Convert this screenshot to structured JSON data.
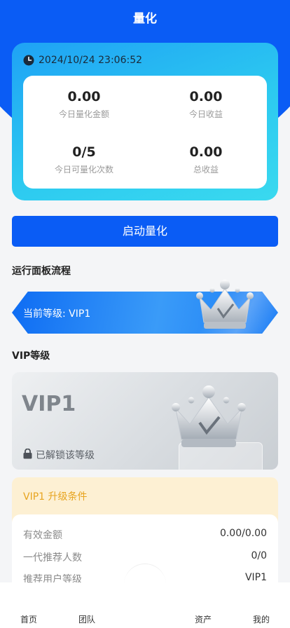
{
  "header": {
    "title": "量化"
  },
  "stats": {
    "datetime": "2024/10/24 23:06:52",
    "items": [
      {
        "value": "0.00",
        "label": "今日量化金额"
      },
      {
        "value": "0.00",
        "label": "今日收益"
      },
      {
        "value": "0/5",
        "label": "今日可量化次数"
      },
      {
        "value": "0.00",
        "label": "总收益"
      }
    ]
  },
  "start_button": {
    "label": "启动量化"
  },
  "process": {
    "title": "运行面板流程",
    "current_level": "当前等级: VIP1"
  },
  "vip": {
    "title": "VIP等级",
    "name": "VIP1",
    "status": "已解锁该等级"
  },
  "upgrade": {
    "title": "VIP1 升级条件",
    "rows": [
      {
        "key": "有效金额",
        "value": "0.00/0.00"
      },
      {
        "key": "一代推荐人数",
        "value": "0/0"
      },
      {
        "key": "推荐用户等级",
        "value": "VIP1"
      }
    ]
  },
  "tabbar": {
    "items": [
      {
        "label": "首页"
      },
      {
        "label": "团队"
      },
      {
        "label": "资产"
      },
      {
        "label": "我的"
      }
    ]
  },
  "colors": {
    "primary": "#0a5cf5",
    "card_gradient_start": "#1fa2f5",
    "card_gradient_end": "#3ad9ef",
    "upgrade_bg": "#fdf0d3",
    "upgrade_title": "#e7a41f"
  }
}
